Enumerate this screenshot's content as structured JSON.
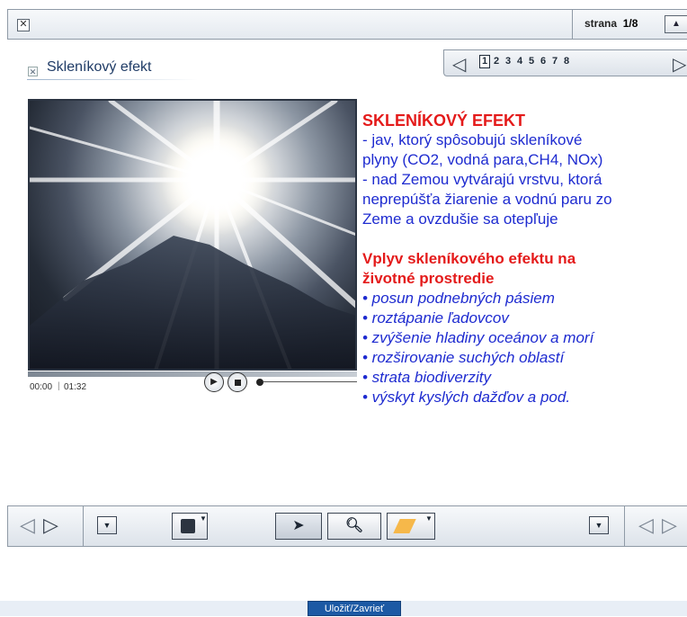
{
  "topbar": {
    "page_label": "strana",
    "page_value": "1/8"
  },
  "pagenav": {
    "pages": [
      "1",
      "2",
      "3",
      "4",
      "5",
      "6",
      "7",
      "8"
    ],
    "active": "1"
  },
  "section": {
    "title": "Skleníkový efekt"
  },
  "video": {
    "time_current": "00:00",
    "time_separator": "|",
    "time_total": "01:32",
    "progress": 0
  },
  "content": {
    "heading1": "SKLENÍKOVÝ EFEKT",
    "para_lines": [
      "- jav, ktorý spôsobujú skleníkové",
      "plyny (CO2, vodná para,CH4, NOx)",
      "- nad Zemou vytvárajú vrstvu, ktorá",
      "neprepúšťa žiarenie a vodnú paru zo",
      "Zeme a ovzdušie sa otepľuje"
    ],
    "heading2_lines": [
      "Vplyv skleníkového efektu na",
      "životné prostredie"
    ],
    "bullets": [
      "• posun podnebných pásiem",
      "•  roztápanie ľadovcov",
      "•  zvýšenie hladiny oceánov a morí",
      "•  rozširovanie suchých oblastí",
      "•  strata biodiverzity",
      "•  výskyt kyslých dažďov a pod."
    ]
  },
  "footer": {
    "save_label": "Uložiť/Zavrieť"
  }
}
